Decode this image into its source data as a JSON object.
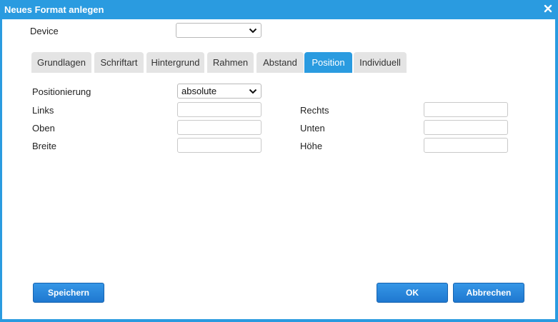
{
  "dialog": {
    "title": "Neues Format anlegen",
    "close_icon": "close-icon",
    "accent": "#2a9be0"
  },
  "device": {
    "label": "Device",
    "value": ""
  },
  "tabs": [
    {
      "label": "Grundlagen",
      "active": false
    },
    {
      "label": "Schriftart",
      "active": false
    },
    {
      "label": "Hintergrund",
      "active": false
    },
    {
      "label": "Rahmen",
      "active": false
    },
    {
      "label": "Abstand",
      "active": false
    },
    {
      "label": "Position",
      "active": true
    },
    {
      "label": "Individuell",
      "active": false
    }
  ],
  "position": {
    "label": "Positionierung",
    "value": "absolute"
  },
  "fields": {
    "links": {
      "label": "Links",
      "value": ""
    },
    "rechts": {
      "label": "Rechts",
      "value": ""
    },
    "oben": {
      "label": "Oben",
      "value": ""
    },
    "unten": {
      "label": "Unten",
      "value": ""
    },
    "breite": {
      "label": "Breite",
      "value": ""
    },
    "hoehe": {
      "label": "Höhe",
      "value": ""
    }
  },
  "buttons": {
    "save": "Speichern",
    "ok": "OK",
    "cancel": "Abbrechen"
  }
}
